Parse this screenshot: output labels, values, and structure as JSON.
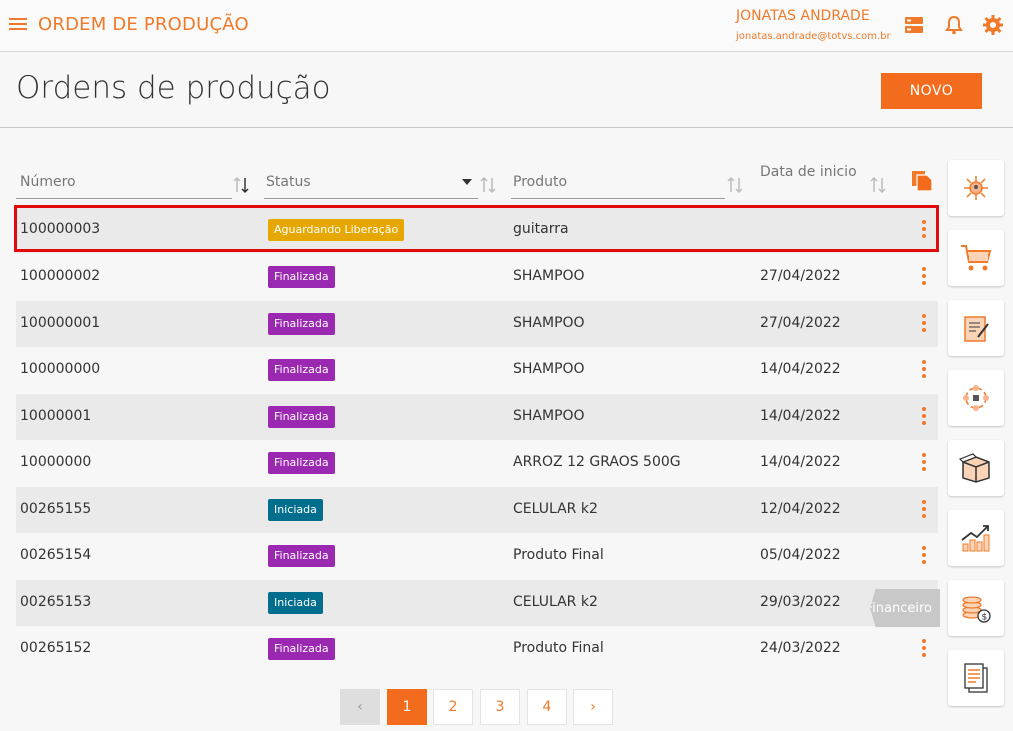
{
  "app": {
    "title": "ORDEM DE PRODUÇÃO",
    "user_name": "JONATAS ANDRADE",
    "user_email": "jonatas.andrade@totvs.com.br"
  },
  "page": {
    "title": "Ordens de produção",
    "new_button": "NOVO"
  },
  "table": {
    "headers": {
      "numero": "Número",
      "status": "Status",
      "produto": "Produto",
      "data": "Data de inicio"
    },
    "rows": [
      {
        "numero": "100000003",
        "status": "Aguardando Liberação",
        "status_type": "agu",
        "produto": "guitarra",
        "data": ""
      },
      {
        "numero": "100000002",
        "status": "Finalizada",
        "status_type": "fin",
        "produto": "SHAMPOO",
        "data": "27/04/2022"
      },
      {
        "numero": "100000001",
        "status": "Finalizada",
        "status_type": "fin",
        "produto": "SHAMPOO",
        "data": "27/04/2022"
      },
      {
        "numero": "100000000",
        "status": "Finalizada",
        "status_type": "fin",
        "produto": "SHAMPOO",
        "data": "14/04/2022"
      },
      {
        "numero": "10000001",
        "status": "Finalizada",
        "status_type": "fin",
        "produto": "SHAMPOO",
        "data": "14/04/2022"
      },
      {
        "numero": "10000000",
        "status": "Finalizada",
        "status_type": "fin",
        "produto": "ARROZ 12 GRAOS 500G",
        "data": "14/04/2022"
      },
      {
        "numero": "00265155",
        "status": "Iniciada",
        "status_type": "ini",
        "produto": "CELULAR k2",
        "data": "12/04/2022"
      },
      {
        "numero": "00265154",
        "status": "Finalizada",
        "status_type": "fin",
        "produto": "Produto Final",
        "data": "05/04/2022"
      },
      {
        "numero": "00265153",
        "status": "Iniciada",
        "status_type": "ini",
        "produto": "CELULAR k2",
        "data": "29/03/2022"
      },
      {
        "numero": "00265152",
        "status": "Finalizada",
        "status_type": "fin",
        "produto": "Produto Final",
        "data": "24/03/2022"
      }
    ]
  },
  "sidebar": {
    "tooltip": "Financeiro",
    "icons": [
      "network-icon",
      "cart-icon",
      "contract-icon",
      "process-icon",
      "box-icon",
      "chart-up-icon",
      "coins-icon",
      "documents-icon"
    ]
  },
  "pager": {
    "pages": [
      "1",
      "2",
      "3",
      "4"
    ],
    "prev": "‹",
    "next": "›"
  },
  "colors": {
    "accent": "#f07a2a",
    "finalizada": "#9b28b0",
    "iniciada": "#006e8c",
    "aguardando": "#e6a800",
    "highlight": "#e10b0b"
  }
}
